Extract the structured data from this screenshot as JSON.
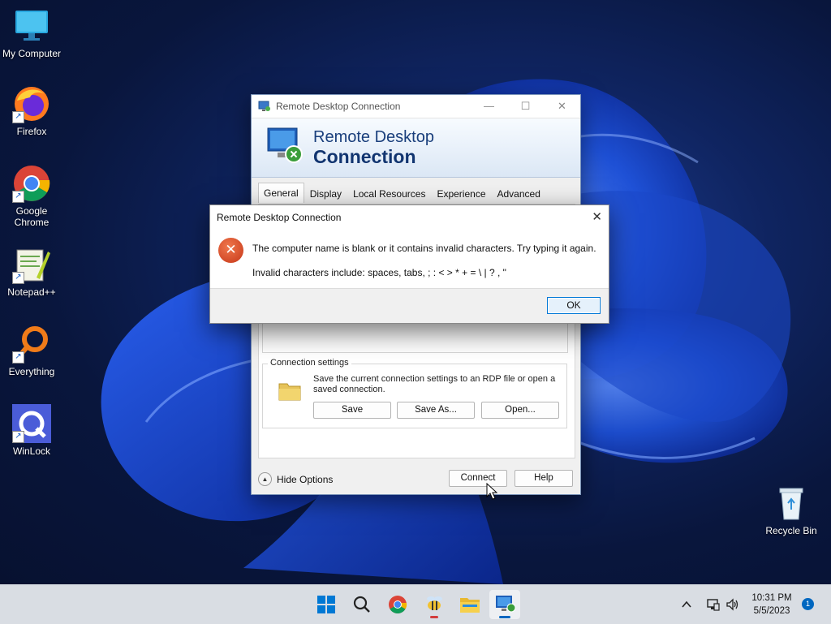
{
  "desktop": {
    "icons": [
      {
        "label": "My Computer"
      },
      {
        "label": "Firefox"
      },
      {
        "label": "Google Chrome"
      },
      {
        "label": "Notepad++"
      },
      {
        "label": "Everything"
      },
      {
        "label": "WinLock"
      },
      {
        "label": "Recycle Bin"
      }
    ]
  },
  "rdp_window": {
    "title": "Remote Desktop Connection",
    "banner_line1": "Remote Desktop",
    "banner_line2": "Connection",
    "tabs": [
      {
        "label": "General",
        "active": true
      },
      {
        "label": "Display"
      },
      {
        "label": "Local Resources"
      },
      {
        "label": "Experience"
      },
      {
        "label": "Advanced"
      }
    ],
    "connection_settings": {
      "legend": "Connection settings",
      "description": "Save the current connection settings to an RDP file or open a saved connection.",
      "save": "Save",
      "save_as": "Save As...",
      "open": "Open..."
    },
    "hide_options": "Hide Options",
    "connect": "Connect",
    "help": "Help"
  },
  "error_dialog": {
    "title": "Remote Desktop Connection",
    "message": "The computer name is blank or it contains invalid characters. Try typing it again.",
    "detail": "Invalid characters include: spaces, tabs, ; : < > * + = \\ | ? , \"",
    "ok": "OK"
  },
  "taskbar": {
    "apps": [
      "start-icon",
      "search-icon",
      "chrome-icon",
      "bee-app-icon",
      "file-explorer-icon",
      "remote-desktop-icon"
    ],
    "time": "10:31 PM",
    "date": "5/5/2023",
    "notification_count": "1"
  },
  "colors": {
    "accent": "#0067c0",
    "error": "#d2431f",
    "banner_text": "#123570"
  }
}
